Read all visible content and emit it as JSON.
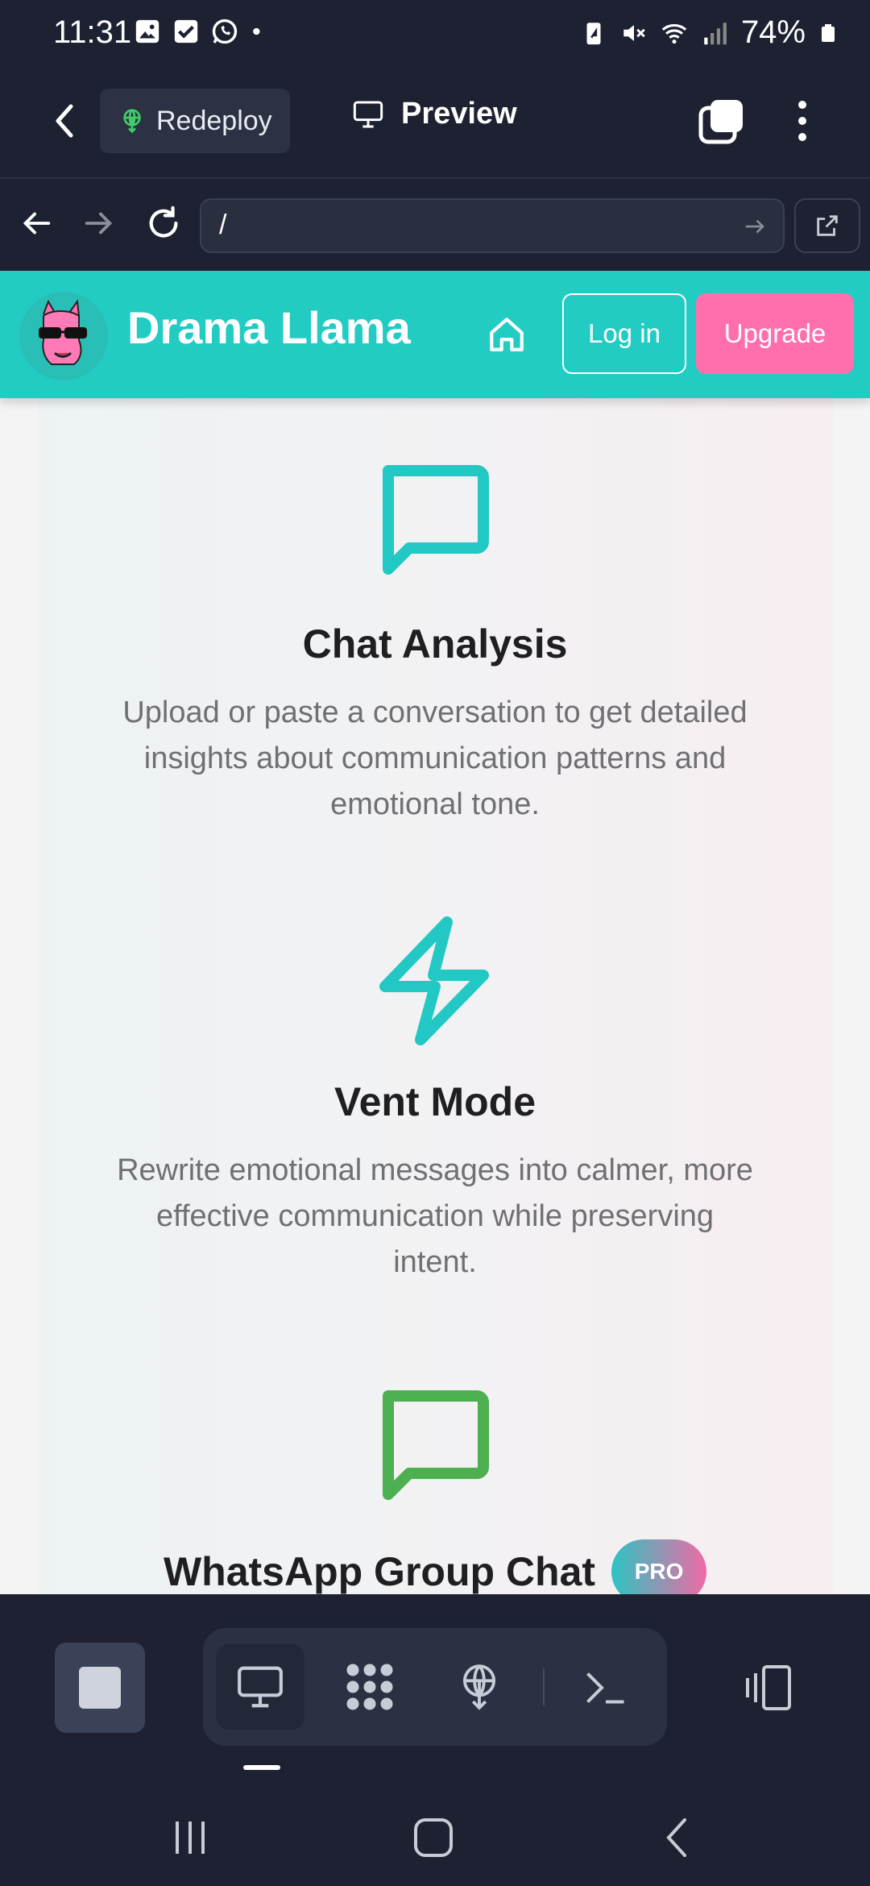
{
  "status_bar": {
    "time": "11:31",
    "battery": "74%",
    "left_icons": [
      "gallery-icon",
      "check-box-icon",
      "whatsapp-icon",
      "dot-icon"
    ],
    "right_icons": [
      "battery-saver-icon",
      "mute-icon",
      "wifi-icon",
      "signal-icon",
      "battery-icon"
    ]
  },
  "app_header": {
    "redeploy_label": "Redeploy",
    "preview_label": "Preview"
  },
  "url_bar": {
    "value": "/"
  },
  "site": {
    "title": "Drama Llama",
    "login_label": "Log in",
    "upgrade_label": "Upgrade"
  },
  "features": [
    {
      "title": "Chat Analysis",
      "description": "Upload or paste a conversation to get detailed insights about communication patterns and emotional tone.",
      "icon": "chat-bubble-icon",
      "color": "#22c9c4"
    },
    {
      "title": "Vent Mode",
      "description": "Rewrite emotional messages into calmer, more effective communication while preserving intent.",
      "icon": "lightning-icon",
      "color": "#22c9c4"
    },
    {
      "title": "WhatsApp Group Chat",
      "badge": "PRO",
      "icon": "chat-bubble-icon",
      "color": "#4caf50"
    }
  ],
  "colors": {
    "site_header": "#22ccc3",
    "upgrade": "#ff6fae",
    "dark_bg": "#1d2131"
  }
}
